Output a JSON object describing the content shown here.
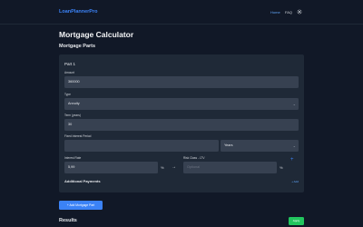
{
  "nav": {
    "brand": "LoanPlannerPro",
    "home": "Home",
    "faq": "FAQ",
    "settings_icon": "gear-icon"
  },
  "page_title": "Mortgage Calculator",
  "section_title": "Mortgage Parts",
  "part": {
    "title": "Part 1",
    "amount_label": "Amount",
    "amount_value": "360000",
    "type_label": "Type",
    "type_value": "Annuity",
    "term_label": "Term (years)",
    "term_value": "30",
    "fixed_label": "Fixed Interest Period",
    "fixed_value": "",
    "fixed_unit": "Years",
    "interest_label": "Interest Rate",
    "interest_value": "5,99",
    "interest_suffix": "%",
    "risk_label": "Risk Class - LTV",
    "risk_placeholder": "Optional",
    "risk_suffix": "%",
    "additional_title": "Additional Payments",
    "additional_add": "+ Add"
  },
  "add_part_button": "+ Add Mortgage Part",
  "results_title": "Results",
  "results_button": "Apply",
  "colors": {
    "accent": "#3b82f6",
    "success": "#22c55e",
    "background": "#111827",
    "card": "#1f2937",
    "field": "#374151"
  }
}
